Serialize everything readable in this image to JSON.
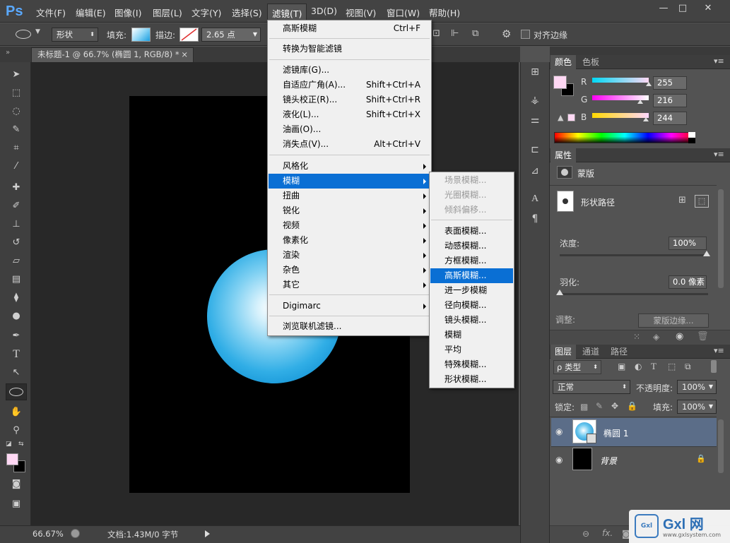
{
  "app": {
    "logo": "Ps"
  },
  "menubar": {
    "items": [
      "文件(F)",
      "编辑(E)",
      "图像(I)",
      "图层(L)",
      "文字(Y)",
      "选择(S)",
      "滤镜(T)",
      "3D(D)",
      "视图(V)",
      "窗口(W)",
      "帮助(H)"
    ],
    "active": "滤镜(T)"
  },
  "window_controls": {
    "minimize": "—",
    "maximize": "□",
    "close": "✕"
  },
  "options": {
    "shape_mode": "形状",
    "fill_label": "填充:",
    "stroke_label": "描边:",
    "stroke_width": "2.65 点",
    "align_edges": "对齐边缘"
  },
  "document_tab": {
    "title": "未标题-1 @ 66.7% (椭圆 1, RGB/8) *",
    "close": "×"
  },
  "status": {
    "zoom": "66.67%",
    "doc_info": "文档:1.43M/0 字节"
  },
  "filter_menu": [
    {
      "label": "高斯模糊",
      "shortcut": "Ctrl+F"
    },
    {
      "sep": true
    },
    {
      "label": "转换为智能滤镜"
    },
    {
      "sep": true
    },
    {
      "label": "滤镜库(G)..."
    },
    {
      "label": "自适应广角(A)...",
      "shortcut": "Shift+Ctrl+A"
    },
    {
      "label": "镜头校正(R)...",
      "shortcut": "Shift+Ctrl+R"
    },
    {
      "label": "液化(L)...",
      "shortcut": "Shift+Ctrl+X"
    },
    {
      "label": "油画(O)..."
    },
    {
      "label": "消失点(V)...",
      "shortcut": "Alt+Ctrl+V"
    },
    {
      "sep": true
    },
    {
      "label": "风格化",
      "submenu": true
    },
    {
      "label": "模糊",
      "submenu": true,
      "highlighted": true
    },
    {
      "label": "扭曲",
      "submenu": true
    },
    {
      "label": "锐化",
      "submenu": true
    },
    {
      "label": "视频",
      "submenu": true
    },
    {
      "label": "像素化",
      "submenu": true
    },
    {
      "label": "渲染",
      "submenu": true
    },
    {
      "label": "杂色",
      "submenu": true
    },
    {
      "label": "其它",
      "submenu": true
    },
    {
      "sep": true
    },
    {
      "label": "Digimarc",
      "submenu": true
    },
    {
      "sep": true
    },
    {
      "label": "浏览联机滤镜..."
    }
  ],
  "blur_submenu": [
    {
      "label": "场景模糊...",
      "disabled": true
    },
    {
      "label": "光圈模糊...",
      "disabled": true
    },
    {
      "label": "倾斜偏移...",
      "disabled": true
    },
    {
      "sep": true
    },
    {
      "label": "表面模糊..."
    },
    {
      "label": "动感模糊..."
    },
    {
      "label": "方框模糊..."
    },
    {
      "label": "高斯模糊...",
      "highlighted": true
    },
    {
      "label": "进一步模糊"
    },
    {
      "label": "径向模糊..."
    },
    {
      "label": "镜头模糊..."
    },
    {
      "label": "模糊"
    },
    {
      "label": "平均"
    },
    {
      "label": "特殊模糊..."
    },
    {
      "label": "形状模糊..."
    }
  ],
  "color_panel": {
    "tabs": [
      "颜色",
      "色板"
    ],
    "r_label": "R",
    "g_label": "G",
    "b_label": "B",
    "r": "255",
    "g": "216",
    "b": "244",
    "foreground": "#ffd8f4",
    "background": "#000000"
  },
  "properties_panel": {
    "tab": "属性",
    "section": "蒙版",
    "shape_path": "形状路径",
    "density_label": "浓度:",
    "density": "100%",
    "feather_label": "羽化:",
    "feather": "0.0 像素",
    "adjust_label": "调整:",
    "mask_edge": "蒙版边缘..."
  },
  "layers_panel": {
    "tabs": [
      "图层",
      "通道",
      "路径"
    ],
    "kind_filter": "ρ 类型",
    "blend_mode": "正常",
    "opacity_label": "不透明度:",
    "opacity": "100%",
    "lock_label": "锁定:",
    "fill_label": "填充:",
    "fill": "100%",
    "layers": [
      {
        "name": "椭圆 1",
        "selected": true
      },
      {
        "name": "背景",
        "locked": true
      }
    ]
  },
  "watermark": {
    "logo": "Gxl 网",
    "url": "www.gxlsystem.com"
  },
  "colors": {
    "highlight": "#0a6fd4",
    "circle": "#1a9ee0"
  }
}
